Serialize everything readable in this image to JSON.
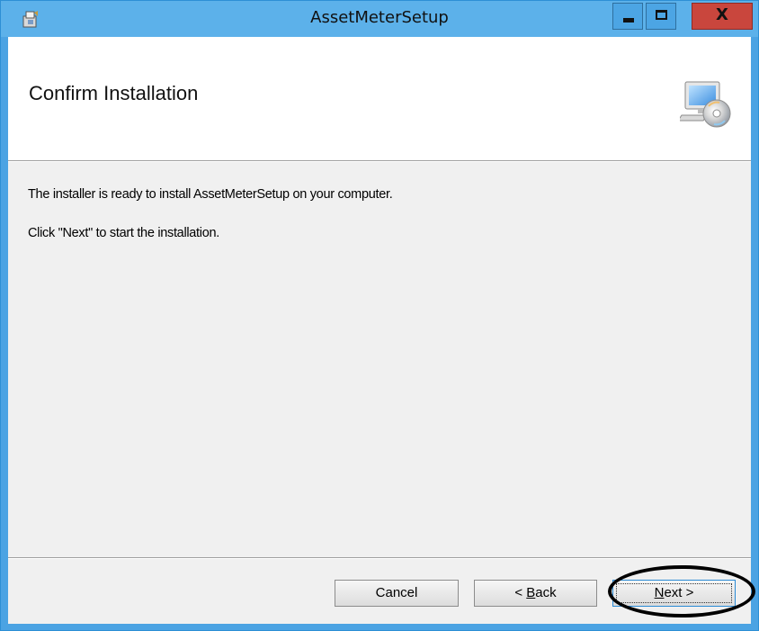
{
  "window": {
    "title": "AssetMeterSetup",
    "controls": {
      "minimize": "minimize",
      "maximize": "maximize",
      "close": "X"
    }
  },
  "banner": {
    "title": "Confirm Installation",
    "icon": "computer-with-disc-icon"
  },
  "body": {
    "line1": "The installer is ready to install AssetMeterSetup on your computer.",
    "line2": "Click \"Next\" to start the installation."
  },
  "buttons": {
    "cancel": "Cancel",
    "back_prefix": "< ",
    "back_mnemonic": "B",
    "back_rest": "ack",
    "next_mnemonic": "N",
    "next_rest": "ext >"
  },
  "colors": {
    "titlebar": "#5cb1ea",
    "close_button": "#c9463d",
    "dialog_background": "#f0f0f0"
  }
}
